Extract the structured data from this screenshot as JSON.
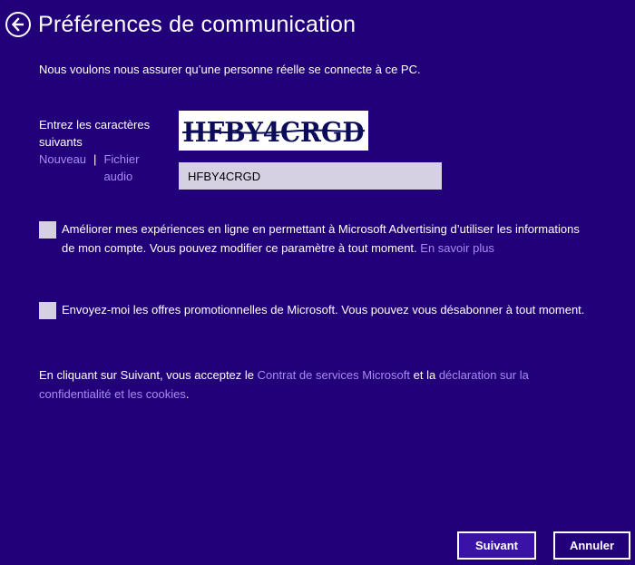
{
  "header": {
    "title": "Préférences de communication",
    "back_icon": "back-arrow-circle-icon"
  },
  "intro_text": "Nous voulons nous assurer qu’une personne réelle se connecte à ce PC.",
  "captcha": {
    "label": "Entrez les caractères suivants",
    "new_link": "Nouveau",
    "separator": "|",
    "audio_link": "Fichier audio",
    "image_text": "HFBY4CRGD",
    "input_value": "HFBY4CRGD"
  },
  "options": [
    {
      "checked": false,
      "text": "Améliorer mes expériences en ligne en permettant à Microsoft Advertising d’utiliser les informations de mon compte. Vous pouvez modifier ce paramètre à tout moment.",
      "link": "En savoir plus"
    },
    {
      "checked": false,
      "text": "Envoyez-moi les offres promotionnelles de Microsoft. Vous pouvez vous désabonner à tout moment."
    }
  ],
  "legal": {
    "prefix": "En cliquant sur Suivant, vous acceptez le",
    "link1": "Contrat de services Microsoft",
    "middle": "et la",
    "link2": "déclaration sur la confidentialité et les cookies",
    "suffix": "."
  },
  "buttons": {
    "next": "Suivant",
    "cancel": "Annuler"
  },
  "colors": {
    "background": "#22007a",
    "link": "#a98af2",
    "field": "#d6d0e3",
    "primary_button": "#3a12a6"
  }
}
